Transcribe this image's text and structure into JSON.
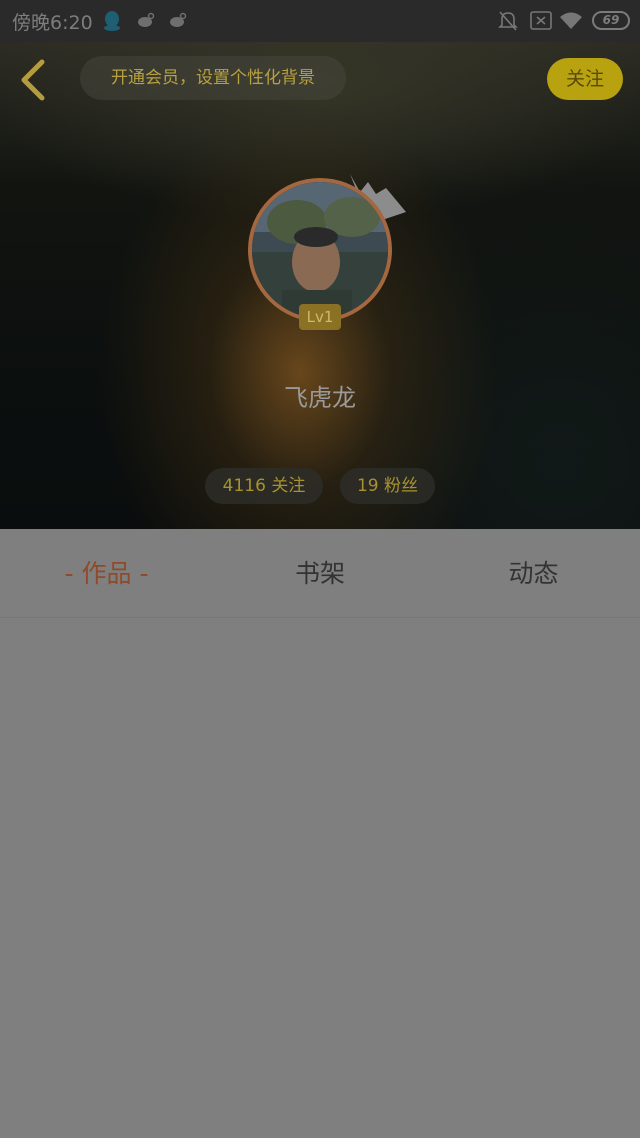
{
  "status_bar": {
    "time": "傍晚6:20",
    "battery": "69",
    "icons": [
      "qq-icon",
      "weibo-icon",
      "weibo-icon",
      "bell-muted-icon",
      "sim-off-icon",
      "wifi-icon",
      "battery-icon"
    ]
  },
  "header": {
    "vip_prompt": "开通会员，设置个性化背景",
    "follow_label": "关注",
    "back_icon": "chevron-left-icon"
  },
  "profile": {
    "username": "飞虎龙",
    "level": "Lv1",
    "following": "4116 关注",
    "fans": "19 粉丝"
  },
  "tabs": [
    {
      "label": "- 作品 -",
      "active": true
    },
    {
      "label": "书架",
      "active": false
    },
    {
      "label": "动态",
      "active": false
    }
  ],
  "colors": {
    "accent": "#b9a20f",
    "active_tab": "#8f4a2a",
    "overlay": "#7f7f7f"
  }
}
